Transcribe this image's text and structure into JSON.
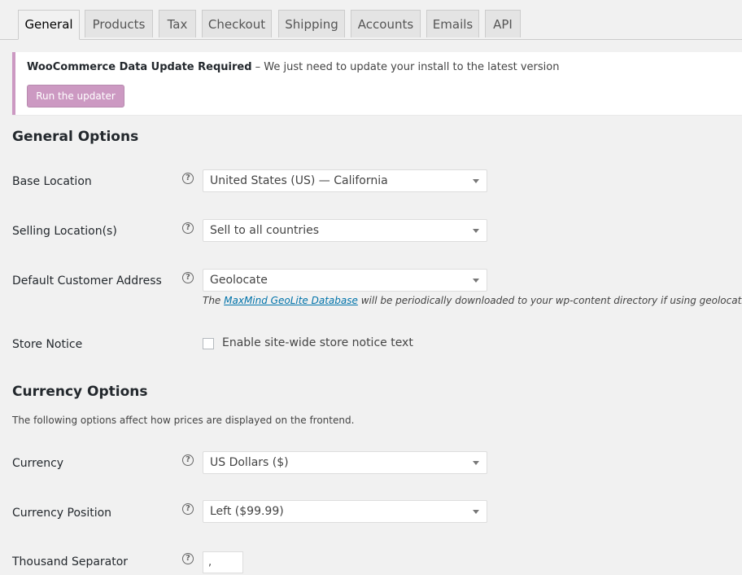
{
  "tabs": [
    "General",
    "Products",
    "Tax",
    "Checkout",
    "Shipping",
    "Accounts",
    "Emails",
    "API"
  ],
  "active_tab": "General",
  "notice": {
    "title": "WooCommerce Data Update Required",
    "message": " – We just need to update your install to the latest version",
    "button": "Run the updater"
  },
  "general": {
    "heading": "General Options",
    "base_location": {
      "label": "Base Location",
      "value": "United States (US) — California"
    },
    "selling_locations": {
      "label": "Selling Location(s)",
      "value": "Sell to all countries"
    },
    "default_address": {
      "label": "Default Customer Address",
      "value": "Geolocate",
      "desc_pre": "The ",
      "desc_link": "MaxMind GeoLite Database",
      "desc_post": " will be periodically downloaded to your wp-content directory if using geolocation."
    },
    "store_notice": {
      "label": "Store Notice",
      "checkbox_label": "Enable site-wide store notice text",
      "checked": false
    }
  },
  "currency": {
    "heading": "Currency Options",
    "intro": "The following options affect how prices are displayed on the frontend.",
    "currency": {
      "label": "Currency",
      "value": "US Dollars ($)"
    },
    "position": {
      "label": "Currency Position",
      "value": "Left ($99.99)"
    },
    "thousand_sep": {
      "label": "Thousand Separator",
      "value": ","
    }
  },
  "colors": {
    "accent": "#cc99c2",
    "link": "#0073aa",
    "background": "#f1f1f1"
  },
  "icons": {
    "help": "help-circle-icon",
    "dropdown": "chevron-down-icon"
  }
}
